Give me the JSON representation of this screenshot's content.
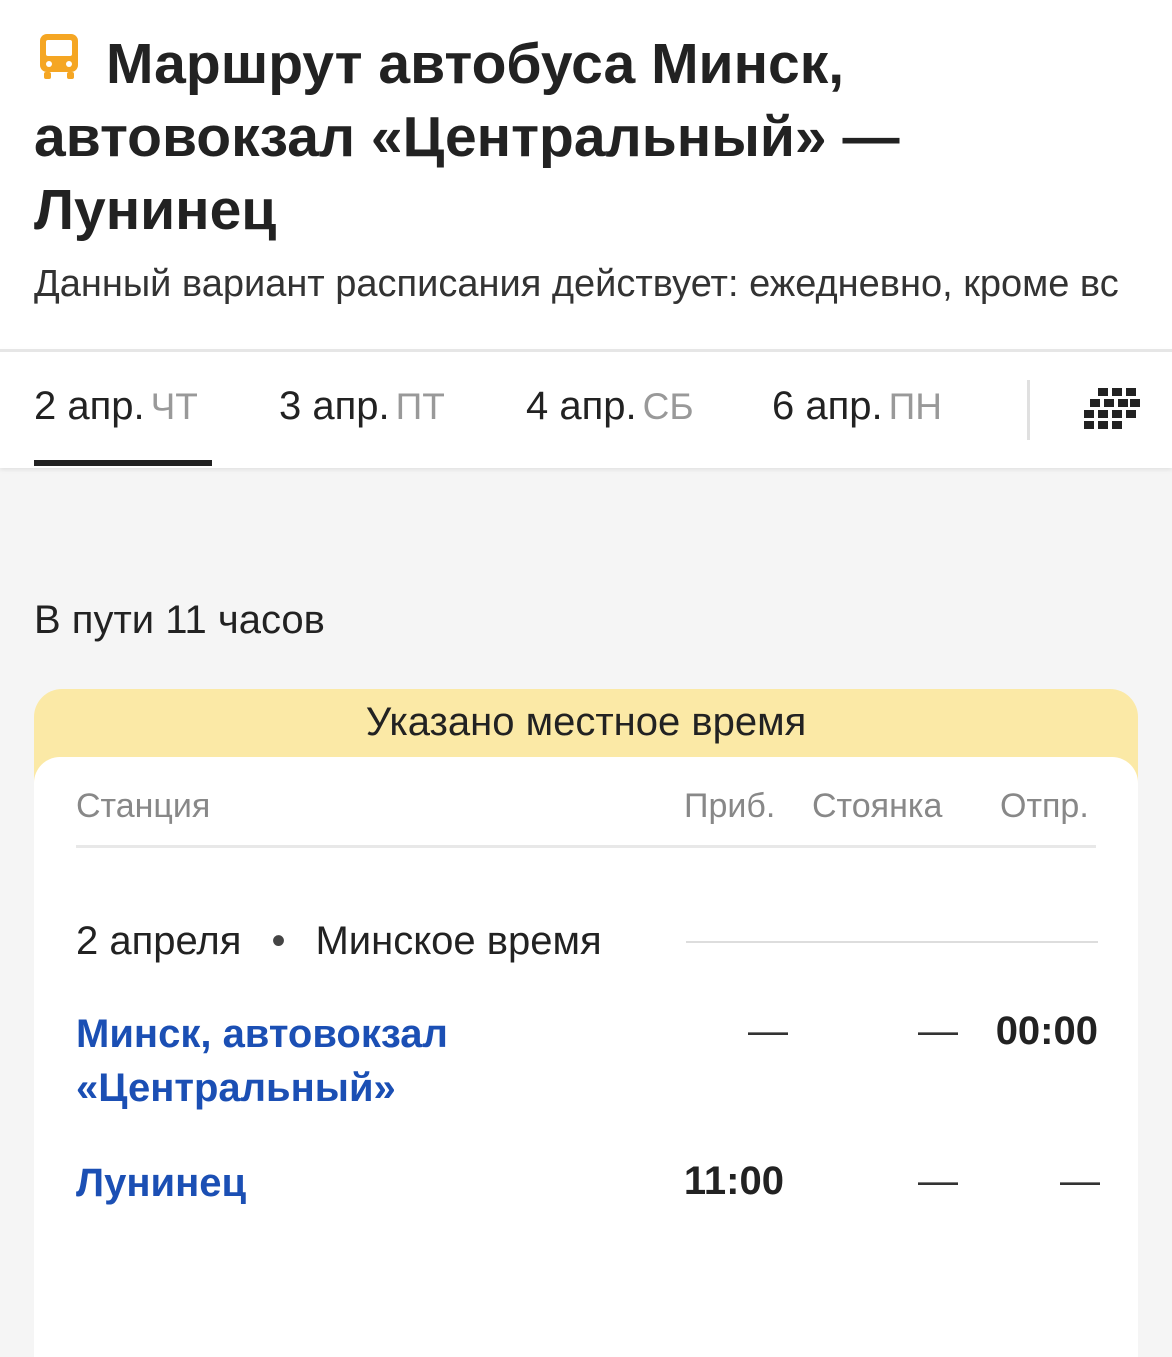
{
  "header": {
    "title": "Маршрут автобуса Минск, автовокзал «Центральный» — Лунинец",
    "subtitle": "Данный вариант расписания действует: ежедневно, кроме вс",
    "bus_icon_color": "#f5a623"
  },
  "tabs": [
    {
      "date": "2 апр.",
      "dow": "ЧТ",
      "active": true
    },
    {
      "date": "3 апр.",
      "dow": "ПТ",
      "active": false
    },
    {
      "date": "4 апр.",
      "dow": "СБ",
      "active": false
    },
    {
      "date": "6 апр.",
      "dow": "ПН",
      "active": false
    }
  ],
  "calendar_icon": "calendar-grid-icon",
  "duration": "В пути 11 часов",
  "notice": "Указано местное время",
  "table": {
    "columns": {
      "station": "Станция",
      "arrival": "Приб.",
      "stop": "Стоянка",
      "departure": "Отпр."
    },
    "date_label": "2 апреля",
    "separator": "•",
    "timezone": "Минское время",
    "rows": [
      {
        "station": "Минск, автовокзал «Центральный»",
        "arrival": "—",
        "stop": "—",
        "departure": "00:00"
      },
      {
        "station": "Лунинец",
        "arrival": "11:00",
        "stop": "—",
        "departure": "—"
      }
    ]
  },
  "colors": {
    "link": "#1b4fb4",
    "notice_bg": "#fbe9a6",
    "page_bg": "#f5f5f5"
  }
}
